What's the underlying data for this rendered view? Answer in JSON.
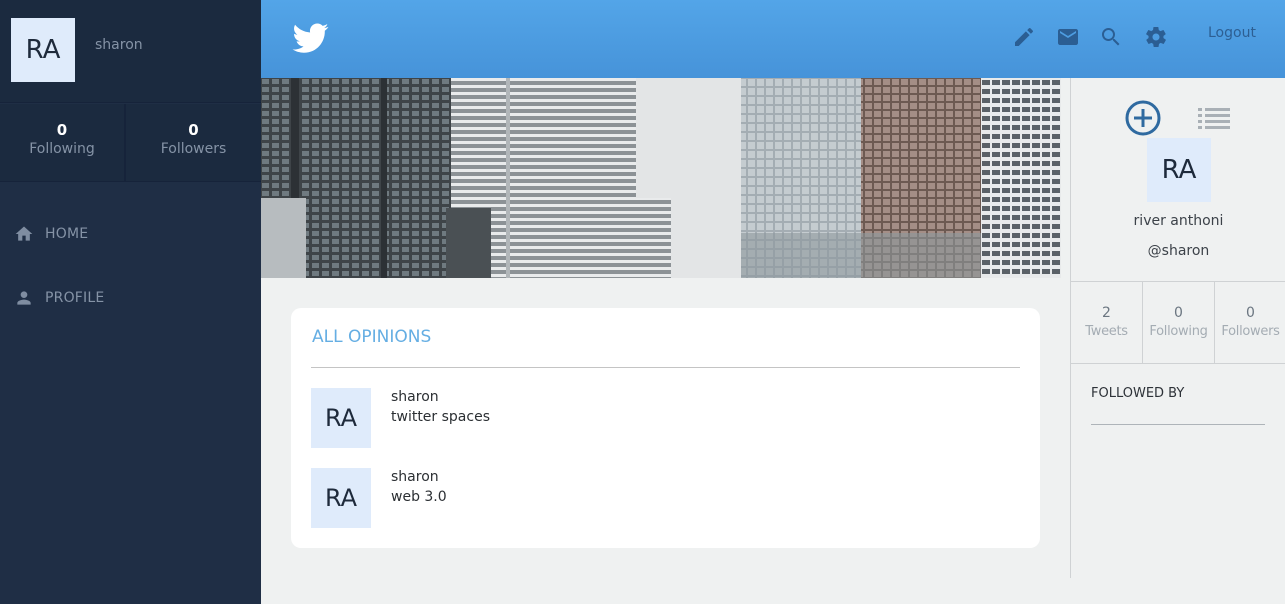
{
  "sidebar": {
    "avatar_initials": "RA",
    "username": "sharon",
    "stats": [
      {
        "value": "0",
        "label": "Following"
      },
      {
        "value": "0",
        "label": "Followers"
      }
    ],
    "nav": [
      {
        "icon": "home-icon",
        "label": "HOME"
      },
      {
        "icon": "person-icon",
        "label": "PROFILE"
      }
    ]
  },
  "header": {
    "logo": "twitter-bird-icon",
    "icons": [
      "pencil-icon",
      "mail-icon",
      "search-icon",
      "gear-icon"
    ],
    "logout_label": "Logout"
  },
  "opinions": {
    "title": "ALL OPINIONS",
    "items": [
      {
        "avatar_initials": "RA",
        "name": "sharon",
        "text": "twitter spaces"
      },
      {
        "avatar_initials": "RA",
        "name": "sharon",
        "text": "web 3.0"
      }
    ]
  },
  "profile": {
    "avatar_initials": "RA",
    "full_name": "river anthoni",
    "handle": "@sharon",
    "stats": [
      {
        "value": "2",
        "label": "Tweets"
      },
      {
        "value": "0",
        "label": "Following"
      },
      {
        "value": "0",
        "label": "Followers"
      }
    ],
    "followed_by_title": "FOLLOWED BY"
  },
  "colors": {
    "sidebar_bg": "#1f2e45",
    "header_accent": "#4a9ae0",
    "title_accent": "#65aee3",
    "avatar_bg": "#dfebfb"
  }
}
